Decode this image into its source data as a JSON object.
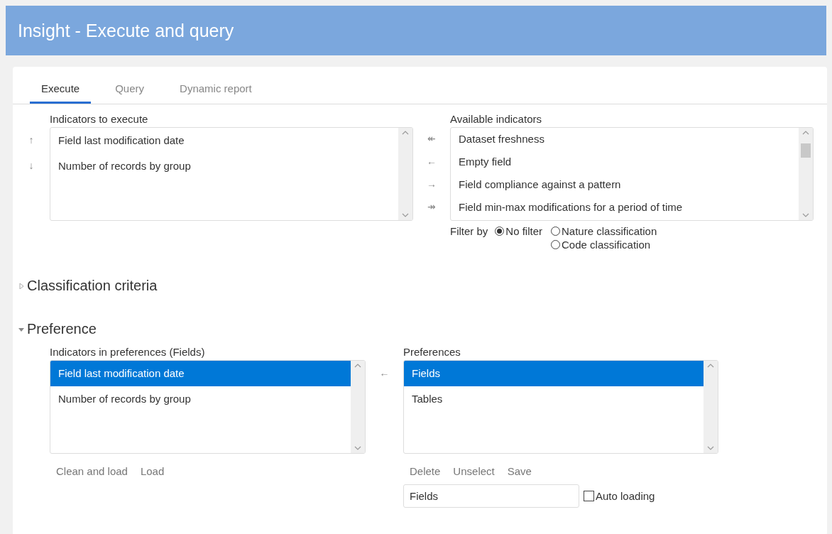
{
  "window": {
    "title": "Insight - Execute and query"
  },
  "tabs": [
    {
      "label": "Execute",
      "selected": true
    },
    {
      "label": "Query",
      "selected": false
    },
    {
      "label": "Dynamic report",
      "selected": false
    }
  ],
  "execute": {
    "indicators_label": "Indicators to execute",
    "order_buttons": [
      "↑",
      "↓"
    ],
    "indicators": [
      {
        "text": "Field last modification date",
        "selected": false
      },
      {
        "text": "Number of records by group",
        "selected": false
      }
    ],
    "transfer_buttons": [
      "↞",
      "←",
      "→",
      "↠"
    ],
    "available_label": "Available indicators",
    "available": [
      {
        "text": "Dataset freshness",
        "selected": false
      },
      {
        "text": "Empty field",
        "selected": false
      },
      {
        "text": "Field compliance against a pattern",
        "selected": false
      },
      {
        "text": "Field min-max modifications for a period of time",
        "selected": false
      }
    ],
    "filter": {
      "label": "Filter by",
      "options": [
        {
          "label": "No filter",
          "selected": true
        },
        {
          "label": "Nature classification",
          "selected": false
        },
        {
          "label": "Code classification",
          "selected": false
        }
      ]
    }
  },
  "sections": [
    {
      "title": "Classification criteria",
      "expanded": false
    },
    {
      "title": "Preference",
      "expanded": true
    }
  ],
  "preference": {
    "indicators_label": "Indicators in preferences (Fields)",
    "indicators": [
      {
        "text": "Field last modification date",
        "selected": true
      },
      {
        "text": "Number of records by group",
        "selected": false
      }
    ],
    "transfer_button": "←",
    "preferences_label": "Preferences",
    "preferences": [
      {
        "text": "Fields",
        "selected": true
      },
      {
        "text": "Tables",
        "selected": false
      }
    ],
    "left_actions": [
      "Clean and load",
      "Load"
    ],
    "right_actions": [
      "Delete",
      "Unselect",
      "Save"
    ],
    "name_field": {
      "value": "Fields"
    },
    "auto_loading": {
      "label": "Auto loading",
      "checked": false
    }
  }
}
